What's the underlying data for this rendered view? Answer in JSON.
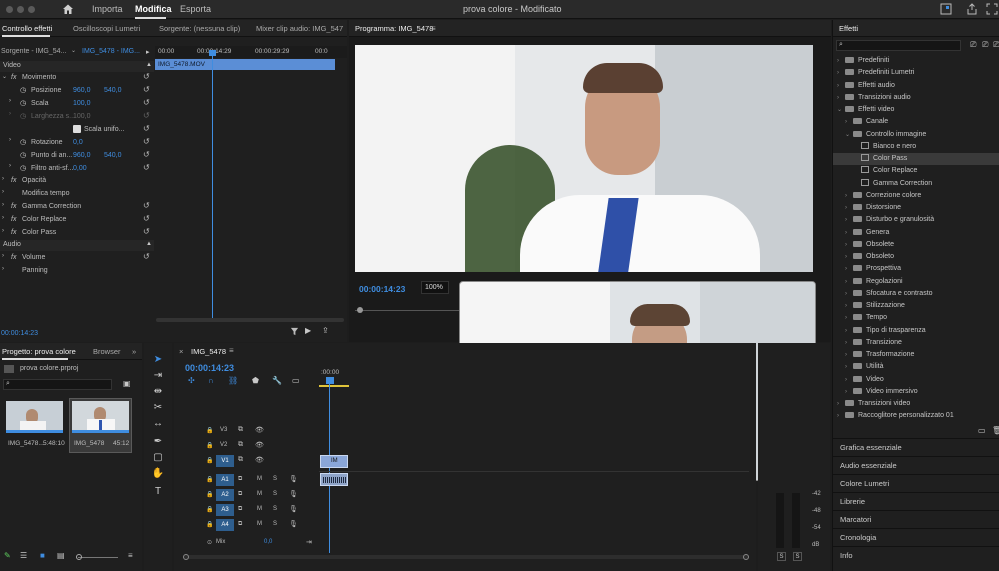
{
  "titlebar": {
    "title": "prova colore - Modificato",
    "menu": [
      "Importa",
      "Modifica",
      "Esporta"
    ]
  },
  "effect_controls": {
    "tabs": [
      "Controllo effetti",
      "Oscilloscopi Lumetri",
      "Sorgente: (nessuna clip)",
      "Mixer clip audio: IMG_547"
    ],
    "source_label": "Sorgente - IMG_54...",
    "clip_selector": "IMG_5478 - IMG...",
    "ruler": [
      "00:00",
      "00:00:14:29",
      "00:00:29:29",
      "00:0"
    ],
    "clip_name": "IMG_5478.MOV",
    "video_label": "Video",
    "audio_label": "Audio",
    "movimento": "Movimento",
    "posizione": {
      "label": "Posizione",
      "x": "960,0",
      "y": "540,0"
    },
    "scala": {
      "label": "Scala",
      "value": "100,0"
    },
    "larghezza": {
      "label": "Larghezza s...",
      "value": "100,0"
    },
    "scala_uniforme": "Scala unifo...",
    "rotazione": {
      "label": "Rotazione",
      "value": "0,0"
    },
    "punto": {
      "label": "Punto di an...",
      "x": "960,0",
      "y": "540,0"
    },
    "filtro": {
      "label": "Filtro anti-sf...",
      "value": "0,00"
    },
    "opacita": "Opacità",
    "modifica_tempo": "Modifica tempo",
    "gamma": "Gamma Correction",
    "color_replace": "Color Replace",
    "color_pass": "Color Pass",
    "volume": "Volume",
    "panning": "Panning",
    "timecode": "00:00:14:23",
    "fx": "fx"
  },
  "program": {
    "title": "Programma: IMG_5478",
    "timecode": "00:00:14:23",
    "zoom": "100%"
  },
  "project": {
    "tabs": [
      "Progetto: prova colore",
      "Browser"
    ],
    "file": "prova colore.prproj",
    "items": [
      {
        "name": "IMG_5478...",
        "duration": "5:48:10"
      },
      {
        "name": "IMG_5478",
        "duration": "45:12"
      }
    ]
  },
  "timeline": {
    "tab": "IMG_5478",
    "timecode": "00:00:14:23",
    "ruler_start": ":00:00",
    "video_tracks": [
      "V3",
      "V2",
      "V1"
    ],
    "audio_tracks": [
      "A1",
      "A2",
      "A3",
      "A4"
    ],
    "mix_label": "Mix",
    "mix_value": "0,0",
    "m": "M",
    "s": "S",
    "clip_label": "IM"
  },
  "meter": {
    "ticks": [
      "-42",
      "-48",
      "-54",
      "dB"
    ],
    "s": "S"
  },
  "effects": {
    "title": "Effetti",
    "tree": [
      {
        "label": "Predefiniti",
        "indent": 0,
        "kind": "folder",
        "caret": "›"
      },
      {
        "label": "Predefiniti Lumetri",
        "indent": 0,
        "kind": "folder",
        "caret": "›"
      },
      {
        "label": "Effetti audio",
        "indent": 0,
        "kind": "folder",
        "caret": "›"
      },
      {
        "label": "Transizioni audio",
        "indent": 0,
        "kind": "folder",
        "caret": "›"
      },
      {
        "label": "Effetti video",
        "indent": 0,
        "kind": "folder",
        "caret": "⌄"
      },
      {
        "label": "Canale",
        "indent": 1,
        "kind": "folder",
        "caret": "›"
      },
      {
        "label": "Controllo immagine",
        "indent": 1,
        "kind": "folder",
        "caret": "⌄"
      },
      {
        "label": "Bianco e nero",
        "indent": 2,
        "kind": "preset",
        "caret": ""
      },
      {
        "label": "Color Pass",
        "indent": 2,
        "kind": "preset",
        "caret": "",
        "selected": true
      },
      {
        "label": "Color Replace",
        "indent": 2,
        "kind": "preset",
        "caret": ""
      },
      {
        "label": "Gamma Correction",
        "indent": 2,
        "kind": "preset",
        "caret": ""
      },
      {
        "label": "Correzione colore",
        "indent": 1,
        "kind": "folder",
        "caret": "›"
      },
      {
        "label": "Distorsione",
        "indent": 1,
        "kind": "folder",
        "caret": "›"
      },
      {
        "label": "Disturbo e granulosità",
        "indent": 1,
        "kind": "folder",
        "caret": "›"
      },
      {
        "label": "Genera",
        "indent": 1,
        "kind": "folder",
        "caret": "›"
      },
      {
        "label": "Obsolete",
        "indent": 1,
        "kind": "folder",
        "caret": "›"
      },
      {
        "label": "Obsoleto",
        "indent": 1,
        "kind": "folder",
        "caret": "›"
      },
      {
        "label": "Prospettiva",
        "indent": 1,
        "kind": "folder",
        "caret": "›"
      },
      {
        "label": "Regolazioni",
        "indent": 1,
        "kind": "folder",
        "caret": "›"
      },
      {
        "label": "Sfocatura e contrasto",
        "indent": 1,
        "kind": "folder",
        "caret": "›"
      },
      {
        "label": "Stilizzazione",
        "indent": 1,
        "kind": "folder",
        "caret": "›"
      },
      {
        "label": "Tempo",
        "indent": 1,
        "kind": "folder",
        "caret": "›"
      },
      {
        "label": "Tipo di trasparenza",
        "indent": 1,
        "kind": "folder",
        "caret": "›"
      },
      {
        "label": "Transizione",
        "indent": 1,
        "kind": "folder",
        "caret": "›"
      },
      {
        "label": "Trasformazione",
        "indent": 1,
        "kind": "folder",
        "caret": "›"
      },
      {
        "label": "Utilità",
        "indent": 1,
        "kind": "folder",
        "caret": "›"
      },
      {
        "label": "Video",
        "indent": 1,
        "kind": "folder",
        "caret": "›"
      },
      {
        "label": "Video immersivo",
        "indent": 1,
        "kind": "folder",
        "caret": "›"
      },
      {
        "label": "Transizioni video",
        "indent": 0,
        "kind": "folder",
        "caret": "›"
      },
      {
        "label": "Raccoglitore personalizzato 01",
        "indent": 0,
        "kind": "folder",
        "caret": "›"
      }
    ],
    "panels": [
      "Grafica essenziale",
      "Audio essenziale",
      "Colore Lumetri",
      "Librerie",
      "Marcatori",
      "Cronologia",
      "Info"
    ]
  }
}
